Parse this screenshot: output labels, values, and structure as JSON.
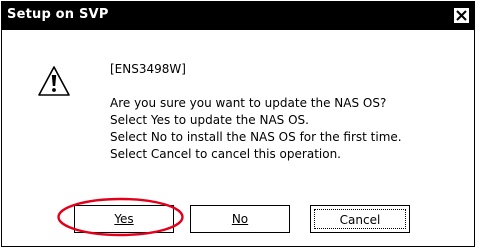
{
  "window": {
    "title": "Setup on SVP"
  },
  "icons": {
    "close": "close-icon",
    "warning": "warning-icon"
  },
  "message": {
    "code": "[ENS3498W]",
    "lines": [
      "Are you sure you want to update the NAS OS?",
      "Select Yes to update the NAS OS.",
      "Select No to install the NAS OS for the first time.",
      "Select Cancel to cancel this operation."
    ]
  },
  "buttons": {
    "yes": "Yes",
    "no": "No",
    "cancel": "Cancel"
  },
  "colors": {
    "highlight": "#e3001b",
    "titlebar": "#000000"
  }
}
